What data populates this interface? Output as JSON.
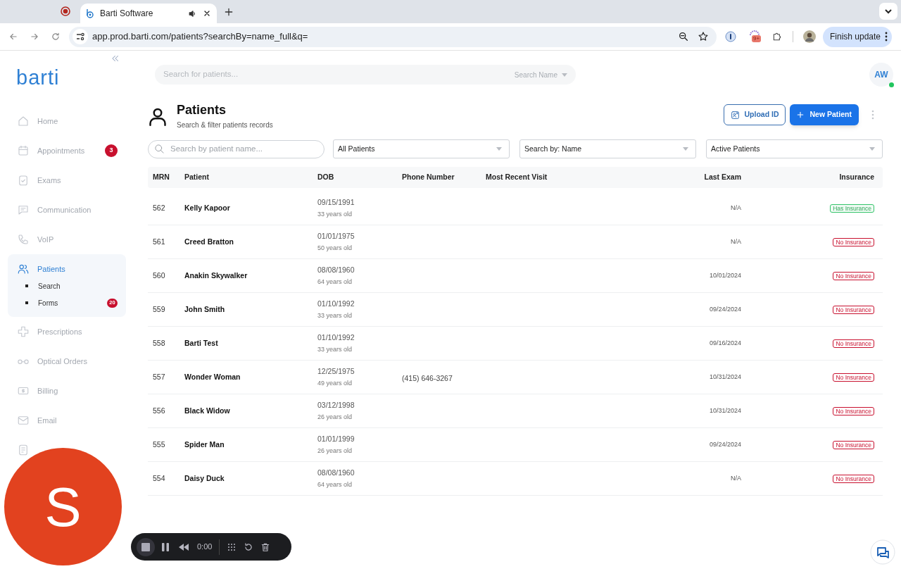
{
  "browser": {
    "tab": {
      "title": "Barti Software",
      "selected": true
    },
    "url": "app.prod.barti.com/patients?searchBy=name_full&q=",
    "extension_badge": "9+",
    "update_button": "Finish update"
  },
  "app": {
    "logo": "barti",
    "top_search": {
      "placeholder": "Search for patients...",
      "mode": "Search Name"
    },
    "user_initials": "AW",
    "user_online": true
  },
  "sidebar": {
    "items": [
      {
        "label": "Home",
        "selected": false
      },
      {
        "label": "Appointments",
        "selected": false,
        "badge": "3"
      },
      {
        "label": "Exams",
        "selected": false
      },
      {
        "label": "Communication",
        "selected": false
      },
      {
        "label": "VoIP",
        "selected": false
      },
      {
        "label": "Patients",
        "selected": true,
        "children": [
          {
            "label": "Search"
          },
          {
            "label": "Forms",
            "badge": "20"
          }
        ]
      },
      {
        "label": "Prescriptions",
        "selected": false
      },
      {
        "label": "Optical Orders",
        "selected": false
      },
      {
        "label": "Billing",
        "selected": false
      },
      {
        "label": "Email",
        "selected": false
      },
      {
        "selected": false
      }
    ]
  },
  "page": {
    "title": "Patients",
    "subtitle": "Search & filter patients records",
    "buttons": [
      "Upload ID",
      "New Patient"
    ],
    "filters": {
      "search_placeholder": "Search by patient name...",
      "selects": [
        "All Patients",
        "Search by: Name",
        "Active Patients"
      ]
    }
  },
  "table": {
    "columns": [
      "MRN",
      "Patient",
      "DOB",
      "Phone Number",
      "Most Recent Visit",
      "Last Exam",
      "Insurance"
    ],
    "rows": [
      {
        "mrn": "562",
        "patient": "Kelly Kapoor",
        "dob": "09/15/1991",
        "age": "33 years old",
        "last_exam": "N/A",
        "insurance": "Has Insurance",
        "insured": true
      },
      {
        "mrn": "561",
        "patient": "Creed Bratton",
        "dob": "01/01/1975",
        "age": "50 years old",
        "last_exam": "N/A",
        "insurance": "No Insurance",
        "insured": false
      },
      {
        "mrn": "560",
        "patient": "Anakin Skywalker",
        "dob": "08/08/1960",
        "age": "64 years old",
        "last_exam": "10/01/2024",
        "insurance": "No Insurance",
        "insured": false
      },
      {
        "mrn": "559",
        "patient": "John Smith",
        "dob": "01/10/1992",
        "age": "33 years old",
        "last_exam": "09/24/2024",
        "insurance": "No Insurance",
        "insured": false
      },
      {
        "mrn": "558",
        "patient": "Barti Test",
        "dob": "01/10/1992",
        "age": "33 years old",
        "last_exam": "09/16/2024",
        "insurance": "No Insurance",
        "insured": false
      },
      {
        "mrn": "557",
        "patient": "Wonder Woman",
        "dob": "12/25/1975",
        "age": "49 years old",
        "phone": "(415) 646-3267",
        "last_exam": "10/31/2024",
        "insurance": "No Insurance",
        "insured": false
      },
      {
        "mrn": "556",
        "patient": "Black Widow",
        "dob": "03/12/1998",
        "age": "26 years old",
        "last_exam": "10/31/2024",
        "insurance": "No Insurance",
        "insured": false
      },
      {
        "mrn": "555",
        "patient": "Spider Man",
        "dob": "01/01/1999",
        "age": "26 years old",
        "last_exam": "09/24/2024",
        "insurance": "No Insurance",
        "insured": false
      },
      {
        "mrn": "554",
        "patient": "Daisy Duck",
        "dob": "08/08/1960",
        "age": "64 years old",
        "last_exam": "N/A",
        "insurance": "No Insurance",
        "insured": false
      }
    ]
  },
  "camera_bubble": {
    "initial": "S"
  },
  "recorder": {
    "time": "0:00"
  }
}
